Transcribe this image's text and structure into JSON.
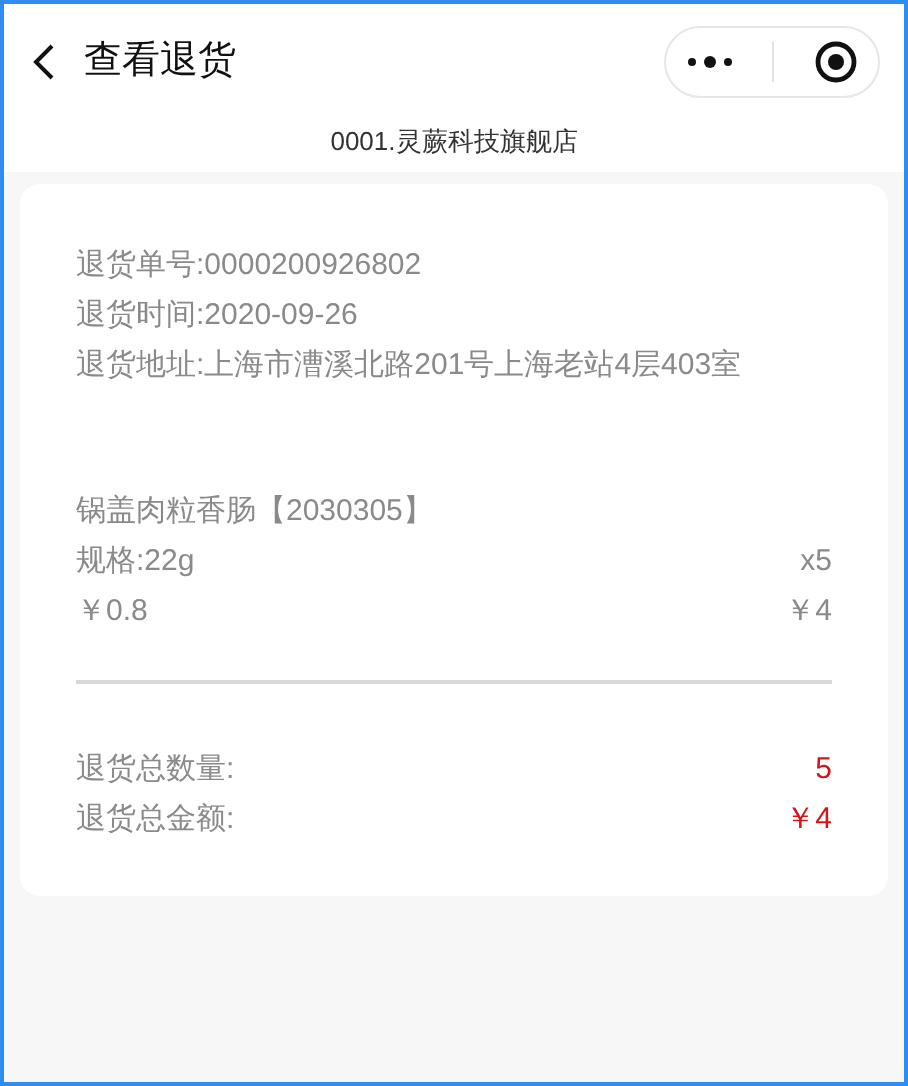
{
  "header": {
    "title": "查看退货"
  },
  "store": "0001.灵蕨科技旗舰店",
  "info": [
    "退货单号:0000200926802",
    "退货时间:2020-09-26",
    "退货地址:上海市漕溪北路201号上海老站4层403室"
  ],
  "item": {
    "name": "锅盖肉粒香肠【2030305】",
    "spec": "规格:22g",
    "quantity": "x5",
    "price": "￥0.8",
    "subtotal": "￥4"
  },
  "totals": [
    {
      "label": "退货总数量:",
      "value": "5"
    },
    {
      "label": "退货总金额:",
      "value": "￥4"
    }
  ]
}
